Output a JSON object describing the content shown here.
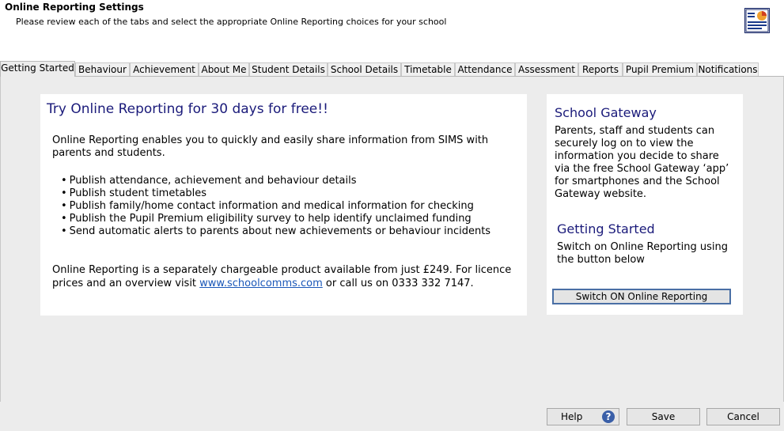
{
  "header": {
    "title": "Online Reporting Settings",
    "subtitle": "Please review each of the tabs and select the appropriate Online Reporting choices for your school",
    "icon": "report-settings-icon"
  },
  "tabs": [
    {
      "label": "Getting Started",
      "active": true
    },
    {
      "label": "Behaviour"
    },
    {
      "label": "Achievement"
    },
    {
      "label": "About Me"
    },
    {
      "label": "Student Details"
    },
    {
      "label": "School Details"
    },
    {
      "label": "Timetable"
    },
    {
      "label": "Attendance"
    },
    {
      "label": "Assessment"
    },
    {
      "label": "Reports"
    },
    {
      "label": "Pupil Premium"
    },
    {
      "label": "Notifications"
    }
  ],
  "promo": {
    "title": "Try Online Reporting for 30 days for free!!",
    "intro": "Online Reporting enables you to quickly and easily share information from SIMS with parents and students.",
    "bullets": [
      "Publish attendance, achievement and behaviour details",
      "Publish student timetables",
      "Publish family/home contact information and medical information for checking",
      "Publish the Pupil Premium eligibility survey to help identify unclaimed funding",
      "Send automatic alerts to parents about new achievements or behaviour incidents"
    ],
    "pricing_pre": "Online Reporting is a separately chargeable product available from just £249. For licence prices and an overview visit ",
    "pricing_link": "www.schoolcomms.com",
    "pricing_post": " or call us on 0333 332 7147."
  },
  "gateway": {
    "title": "School Gateway",
    "text": "Parents, staff and students can securely log on to view the information you decide to share via the free School Gateway ‘app’ for smartphones and the School Gateway website."
  },
  "getting_started": {
    "title": "Getting Started",
    "text": "Switch on Online Reporting using the button below",
    "button": "Switch ON Online Reporting"
  },
  "footer": {
    "help": "Help",
    "help_icon": "?",
    "save": "Save",
    "cancel": "Cancel"
  },
  "colors": {
    "heading": "#1a1a7a",
    "link": "#1a57b8",
    "panel_bg": "#ececec",
    "button_border": "#4a6fa5"
  }
}
